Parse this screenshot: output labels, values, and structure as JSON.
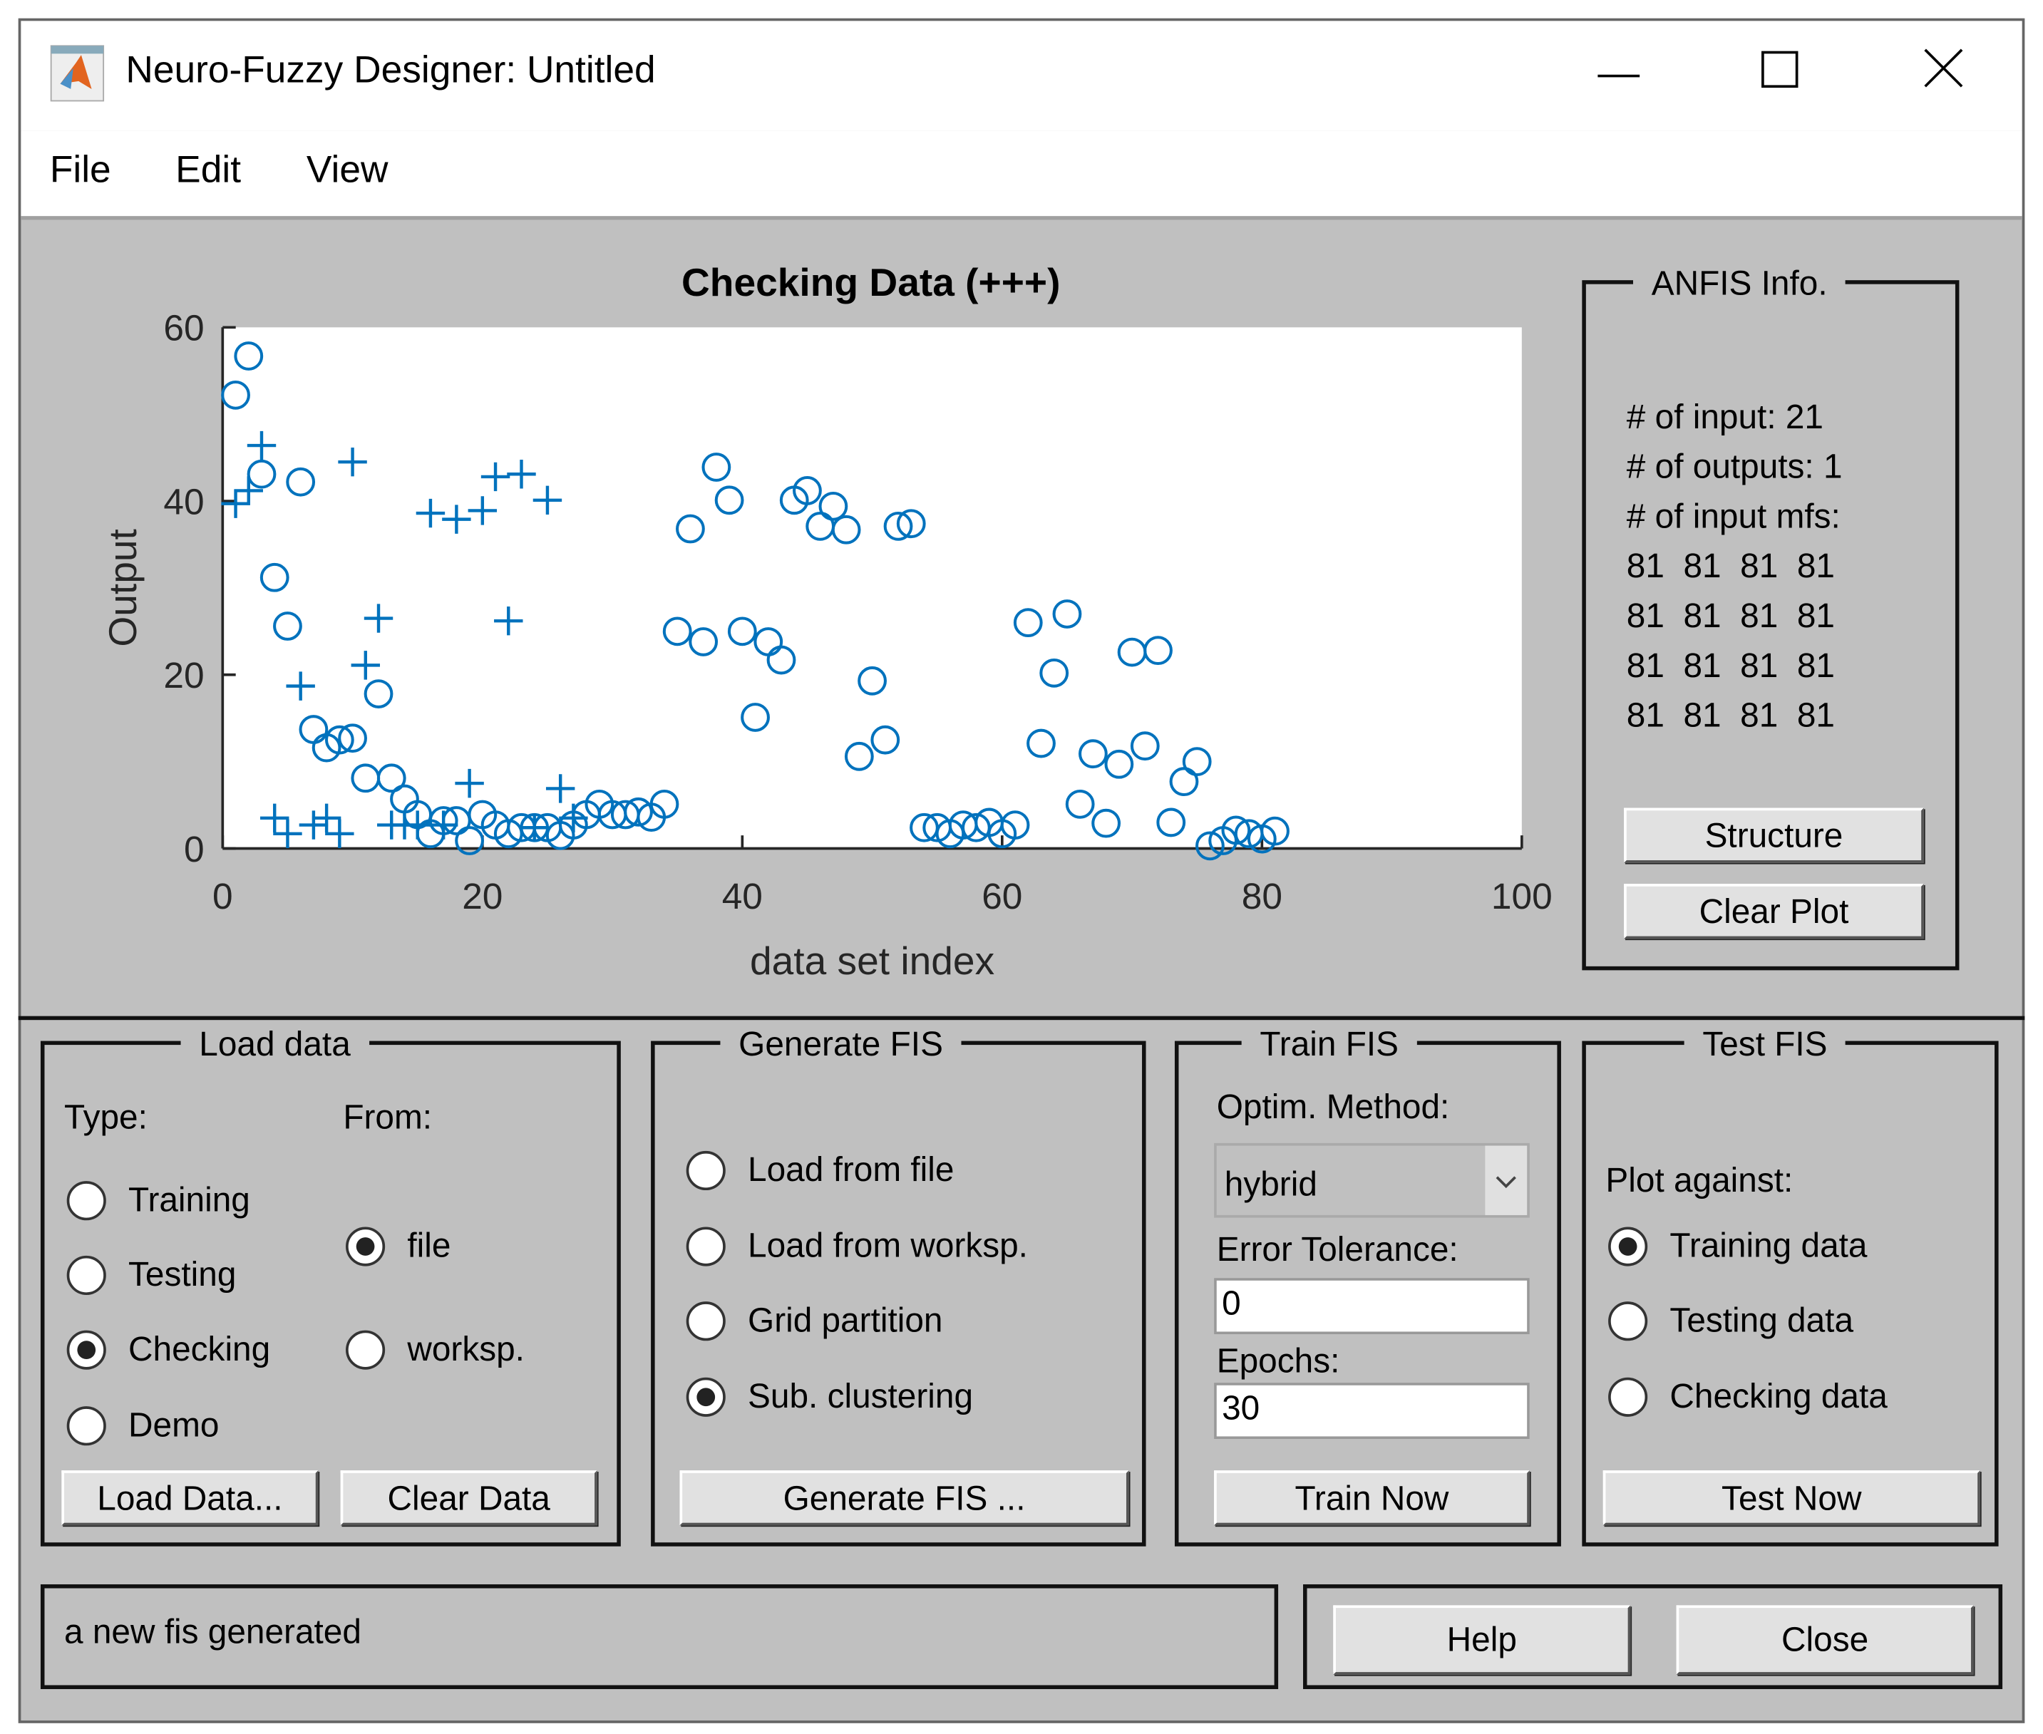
{
  "window": {
    "title": "Neuro-Fuzzy Designer: Untitled",
    "minimize_icon": "minimize-icon",
    "maximize_icon": "maximize-icon",
    "close_icon": "close-icon"
  },
  "menu": [
    "File",
    "Edit",
    "View"
  ],
  "plot": {
    "title": "Checking Data (+++)"
  },
  "chart_data": {
    "type": "scatter",
    "title": "Checking Data (+++)",
    "xlabel": "data set index",
    "ylabel": "Output",
    "xlim": [
      0,
      100
    ],
    "ylim": [
      0,
      60
    ],
    "xticks": [
      "0",
      "20",
      "40",
      "60",
      "80",
      "100"
    ],
    "yticks": [
      "0",
      "20",
      "40",
      "60"
    ],
    "grid": false,
    "color": "#0072BD",
    "series": [
      {
        "marker": "o",
        "x": [
          1,
          2,
          3,
          4,
          5,
          6,
          7,
          8,
          9,
          10,
          11,
          12,
          13,
          14,
          15,
          16,
          17,
          18,
          19,
          20,
          21,
          22,
          23,
          24,
          25,
          26,
          27,
          28,
          29,
          30,
          31,
          32,
          33,
          34,
          35,
          36,
          37,
          38,
          39,
          40,
          41,
          42,
          43,
          44,
          45,
          46,
          47,
          48,
          49,
          50,
          51,
          52,
          53,
          54,
          55,
          56,
          57,
          58,
          59,
          60,
          61,
          62,
          63,
          64,
          65,
          66,
          67,
          68,
          69,
          70,
          71,
          72,
          73,
          74,
          75,
          76,
          77,
          78,
          79,
          80,
          81
        ],
        "y": [
          52.2,
          56.7,
          43.1,
          31.2,
          25.6,
          42.2,
          13.7,
          11.6,
          12.5,
          12.7,
          8.1,
          17.8,
          8.1,
          5.7,
          3.9,
          1.7,
          3.2,
          3.2,
          0.9,
          3.9,
          2.7,
          1.7,
          2.4,
          2.4,
          2.4,
          1.5,
          2.7,
          3.9,
          5.1,
          3.9,
          3.9,
          4.2,
          3.6,
          5.1,
          25,
          36.8,
          23.8,
          43.9,
          40.1,
          25,
          15.1,
          23.8,
          21.7,
          40.1,
          41.2,
          37.1,
          39.4,
          36.7,
          10.6,
          19.3,
          12.5,
          37.1,
          37.4,
          2.4,
          2.4,
          1.7,
          2.7,
          2.4,
          3,
          1.7,
          2.7,
          26,
          12.1,
          20.2,
          27,
          5.1,
          10.9,
          2.9,
          9.7,
          22.6,
          11.8,
          22.8,
          3,
          7.7,
          10,
          0.3,
          0.9,
          2.1,
          1.7,
          1.1,
          2
        ]
      },
      {
        "marker": "+",
        "x": [
          1,
          2,
          3,
          4,
          5,
          6,
          7,
          8,
          9,
          10,
          11,
          12,
          13,
          14,
          15,
          16,
          17,
          18,
          19,
          20,
          21,
          22,
          23,
          24,
          25,
          26,
          27
        ],
        "y": [
          39.7,
          41.2,
          46.4,
          3.5,
          1.7,
          18.7,
          2.7,
          3.5,
          1.7,
          44.5,
          21.1,
          26.5,
          2.7,
          2.7,
          2.7,
          38.6,
          2.7,
          37.9,
          7.5,
          38.9,
          42.8,
          26.2,
          43.1,
          2.4,
          40.1,
          6.9,
          3.5
        ]
      }
    ]
  },
  "anfis": {
    "title": "ANFIS Info.",
    "lines": [
      "# of input: 21",
      "# of outputs: 1",
      "# of input mfs:",
      "81  81  81  81",
      "81  81  81  81",
      "81  81  81  81",
      "81  81  81  81"
    ],
    "structure": "Structure",
    "clear_plot": "Clear Plot"
  },
  "load": {
    "title": "Load data",
    "type_label": "Type:",
    "from_label": "From:",
    "types": [
      "Training",
      "Testing",
      "Checking",
      "Demo"
    ],
    "type_selected": "Checking",
    "from": [
      "file",
      "worksp."
    ],
    "from_selected": "file",
    "load_btn": "Load Data...",
    "clear_btn": "Clear Data"
  },
  "generate": {
    "title": "Generate FIS",
    "options": [
      "Load from file",
      "Load from worksp.",
      "Grid partition",
      "Sub. clustering"
    ],
    "selected": "Sub. clustering",
    "btn": "Generate FIS ..."
  },
  "train": {
    "title": "Train FIS",
    "optim_label": "Optim. Method:",
    "optim_value": "hybrid",
    "err_label": "Error Tolerance:",
    "err_value": "0",
    "epochs_label": "Epochs:",
    "epochs_value": "30",
    "btn": "Train Now"
  },
  "test": {
    "title": "Test FIS",
    "plot_label": "Plot against:",
    "options": [
      "Training data",
      "Testing data",
      "Checking data"
    ],
    "selected": "Training data",
    "btn": "Test Now"
  },
  "status": "a new fis generated",
  "help": "Help",
  "close": "Close"
}
